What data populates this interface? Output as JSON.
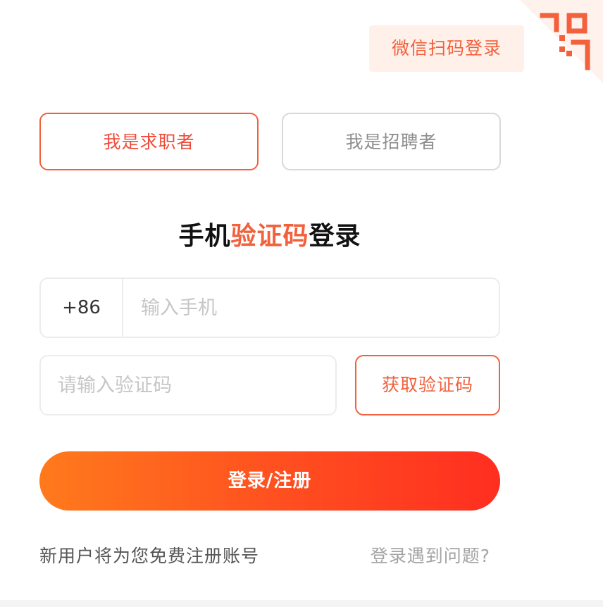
{
  "colors": {
    "accent": "#f2603c",
    "accent_light_bg": "#fff1ea",
    "button_gradient_start": "#ff7a1c",
    "button_gradient_end": "#ff2e20",
    "border": "#ececec",
    "placeholder": "#c6c6c6"
  },
  "qr_toggle": {
    "icon": "qr-code-icon",
    "tip_label": "微信扫码登录"
  },
  "roles": [
    {
      "label": "我是求职者",
      "selected": true
    },
    {
      "label": "我是招聘者",
      "selected": false
    }
  ],
  "title": {
    "part1": "手机",
    "highlight": "验证码",
    "part2": "登录"
  },
  "phone": {
    "country_code": "+86",
    "placeholder": "输入手机"
  },
  "code": {
    "placeholder": "请输入验证码",
    "get_code_label": "获取验证码"
  },
  "submit_label": "登录/注册",
  "footer": {
    "note": "新用户将为您免费注册账号",
    "help_link": "登录遇到问题?"
  }
}
